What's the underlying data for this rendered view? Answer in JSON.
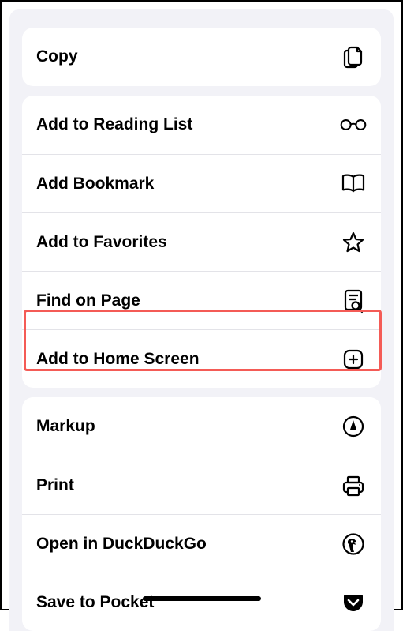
{
  "groups": [
    {
      "rows": [
        {
          "name": "copy",
          "label": "Copy",
          "icon": "doc-on-doc"
        }
      ]
    },
    {
      "rows": [
        {
          "name": "add-reading-list",
          "label": "Add to Reading List",
          "icon": "glasses"
        },
        {
          "name": "add-bookmark",
          "label": "Add Bookmark",
          "icon": "book"
        },
        {
          "name": "add-favorites",
          "label": "Add to Favorites",
          "icon": "star"
        },
        {
          "name": "find-on-page",
          "label": "Find on Page",
          "icon": "doc-search"
        },
        {
          "name": "add-home-screen",
          "label": "Add to Home Screen",
          "icon": "plus-app",
          "highlighted": true
        }
      ]
    },
    {
      "rows": [
        {
          "name": "markup",
          "label": "Markup",
          "icon": "pen-circle"
        },
        {
          "name": "print",
          "label": "Print",
          "icon": "printer"
        },
        {
          "name": "open-duckduckgo",
          "label": "Open in DuckDuckGo",
          "icon": "duck"
        },
        {
          "name": "save-to-pocket",
          "label": "Save to Pocket",
          "icon": "pocket"
        }
      ]
    }
  ]
}
